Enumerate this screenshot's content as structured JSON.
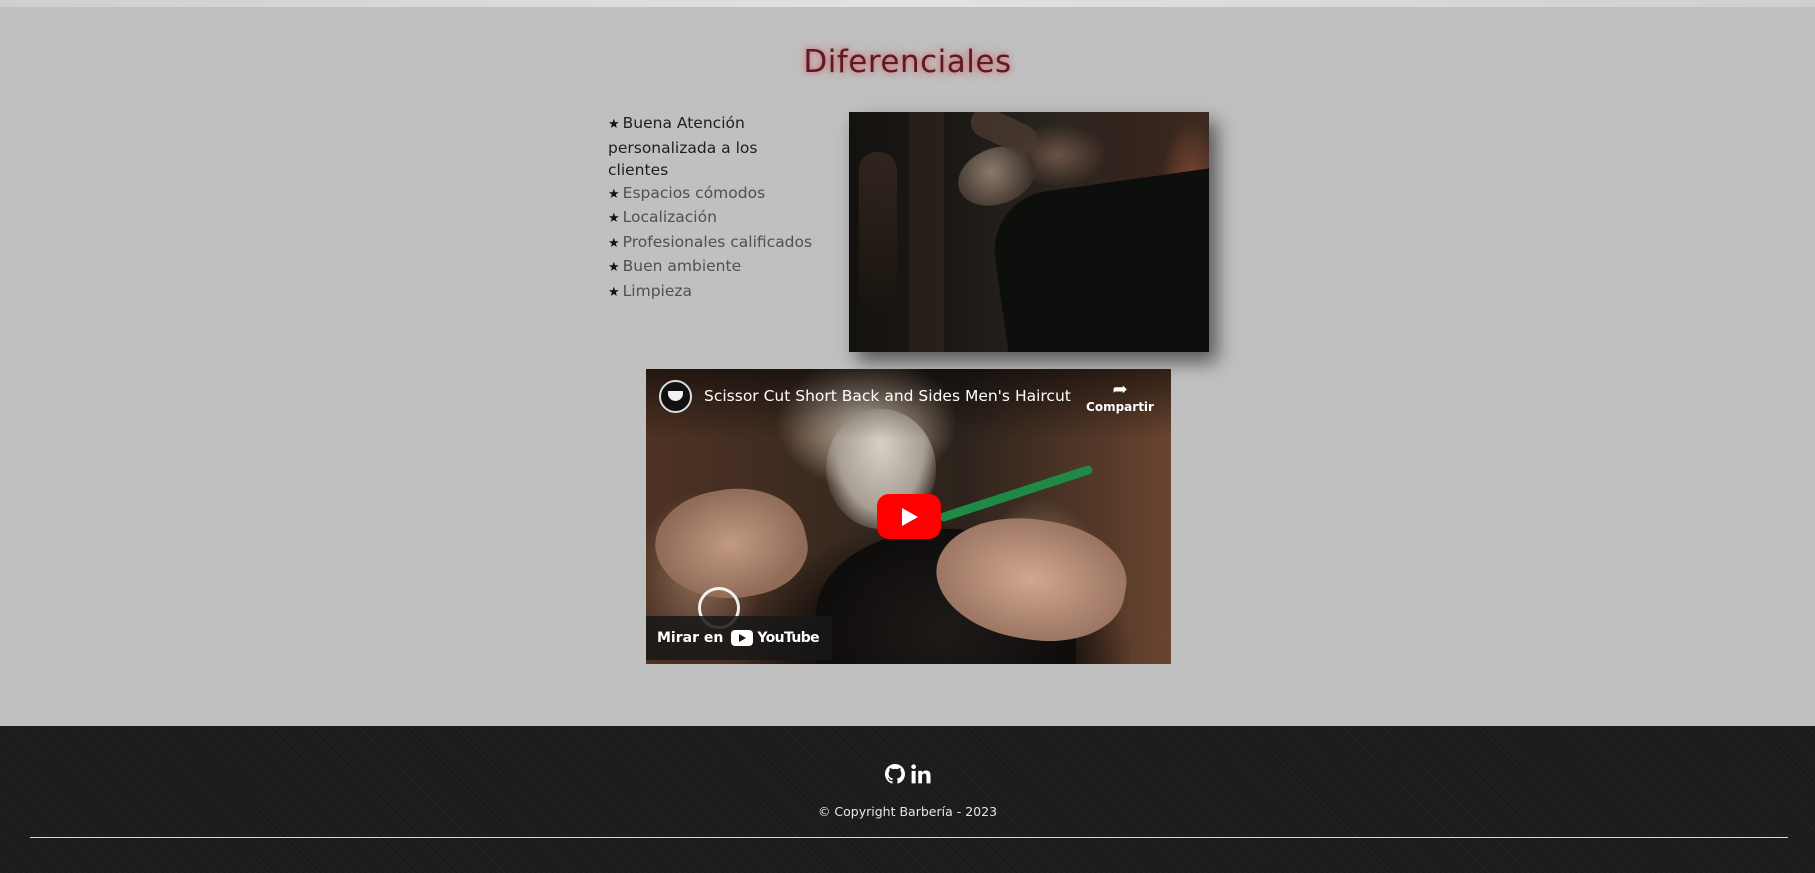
{
  "section": {
    "title": "Diferenciales"
  },
  "features": {
    "star": "★",
    "items": [
      "Buena Atención personalizada a los clientes",
      "Espacios cómodos",
      "Localización",
      "Profesionales calificados",
      "Buen ambiente",
      "Limpieza"
    ]
  },
  "photo": {
    "subject": "barber shaving a reclining client"
  },
  "video": {
    "title": "Scissor Cut Short Back and Sides Men's Haircut",
    "share_label": "Compartir",
    "watch_label": "Mirar en",
    "platform_label": "YouTube",
    "play_color": "#ff0000"
  },
  "footer": {
    "icons": [
      "github-icon",
      "linkedin-icon"
    ],
    "copyright": "© Copyright Barbería - 2023"
  },
  "colors": {
    "page_bg": "#c0c0c0",
    "title_glow": "#dc4650",
    "footer_bg": "#1b1d1c"
  }
}
